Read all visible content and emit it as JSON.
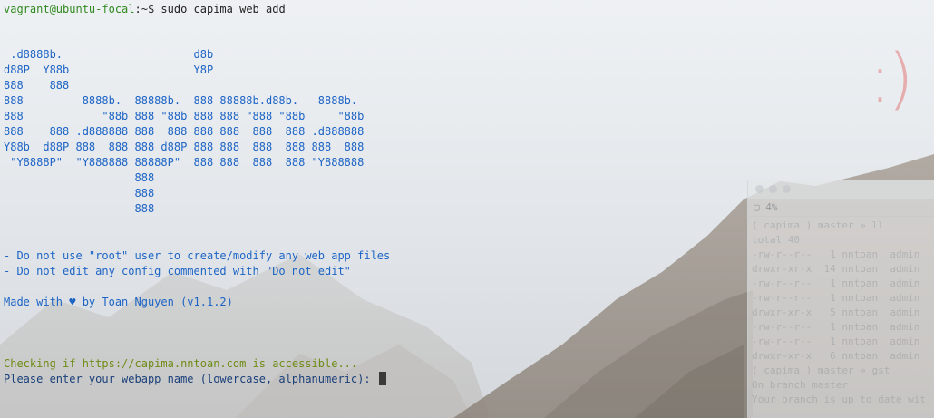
{
  "prompt": {
    "user_host": "vagrant@ubuntu-focal",
    "path": ":~",
    "symbol": "$",
    "command": " sudo capima web add"
  },
  "ascii_art": [
    " .d8888b.                    d8b",
    "d88P  Y88b                   Y8P",
    "888    888",
    "888         8888b.  88888b.  888 88888b.d88b.   8888b.",
    "888            \"88b 888 \"88b 888 888 \"888 \"88b     \"88b",
    "888    888 .d888888 888  888 888 888  888  888 .d888888",
    "Y88b  d88P 888  888 888 d88P 888 888  888  888 888  888",
    " \"Y8888P\"  \"Y888888 88888P\"  888 888  888  888 \"Y888888",
    "                    888",
    "                    888",
    "                    888"
  ],
  "notices": [
    "- Do not use \"root\" user to create/modify any web app files",
    "- Do not edit any config commented with \"Do not edit\""
  ],
  "credit": "Made with ♥ by Toan Nguyen (v1.1.2)",
  "status": "Checking if https://capima.nntoan.com is accessible...",
  "input_prompt": "Please enter your webapp name (lowercase, alphanumeric): ",
  "overlay": {
    "smiley": ":)"
  },
  "background_window": {
    "tab_label": "4%",
    "lines": [
      "( capima ) master » ll",
      "total 40",
      "-rw-r--r--   1 nntoan  admin",
      "drwxr-xr-x  14 nntoan  admin",
      "-rw-r--r--   1 nntoan  admin",
      "-rw-r--r--   1 nntoan  admin",
      "drwxr-xr-x   5 nntoan  admin",
      "-rw-r--r--   1 nntoan  admin",
      "-rw-r--r--   1 nntoan  admin",
      "drwxr-xr-x   6 nntoan  admin",
      "( capima ) master » gst",
      "On branch master",
      "Your branch is up to date wit"
    ]
  },
  "colors": {
    "prompt_user": "#2f8a1f",
    "ascii_blue": "#1d64c5",
    "status_green": "#6e8c14",
    "smiley_pink": "#e27878"
  }
}
